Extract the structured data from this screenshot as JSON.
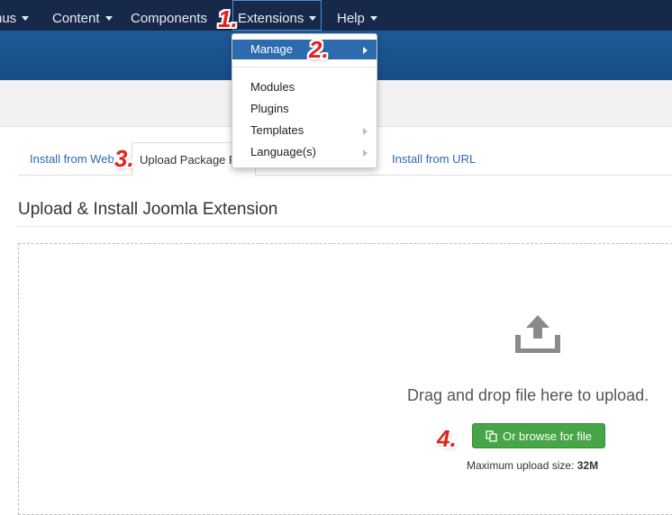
{
  "topnav": {
    "items": [
      {
        "label": "nus"
      },
      {
        "label": "Content"
      },
      {
        "label": "Components"
      },
      {
        "label": "Extensions"
      },
      {
        "label": "Help"
      }
    ]
  },
  "dropdown": {
    "items": [
      {
        "label": "Manage"
      },
      {
        "label": "Modules"
      },
      {
        "label": "Plugins"
      },
      {
        "label": "Templates"
      },
      {
        "label": "Language(s)"
      }
    ]
  },
  "tabs": {
    "items": [
      {
        "label": "Install from Web"
      },
      {
        "label": "Upload Package File"
      },
      {
        "label": "Install from URL"
      }
    ]
  },
  "main": {
    "title": "Upload & Install Joomla Extension",
    "drag_text": "Drag and drop file here to upload.",
    "browse_label": "Or browse for file",
    "max_label": "Maximum upload size:",
    "max_value": "32M"
  },
  "steps": [
    "1.",
    "2.",
    "3.",
    "4."
  ],
  "colors": {
    "nav_bg": "#17294a",
    "header_bg": "#1d5a98",
    "accent_button": "#46a546",
    "menu_active": "#2d6aae",
    "step_marker": "#e0251b"
  },
  "icons": {
    "upload": "upload-icon",
    "browse": "file-copy-icon"
  }
}
